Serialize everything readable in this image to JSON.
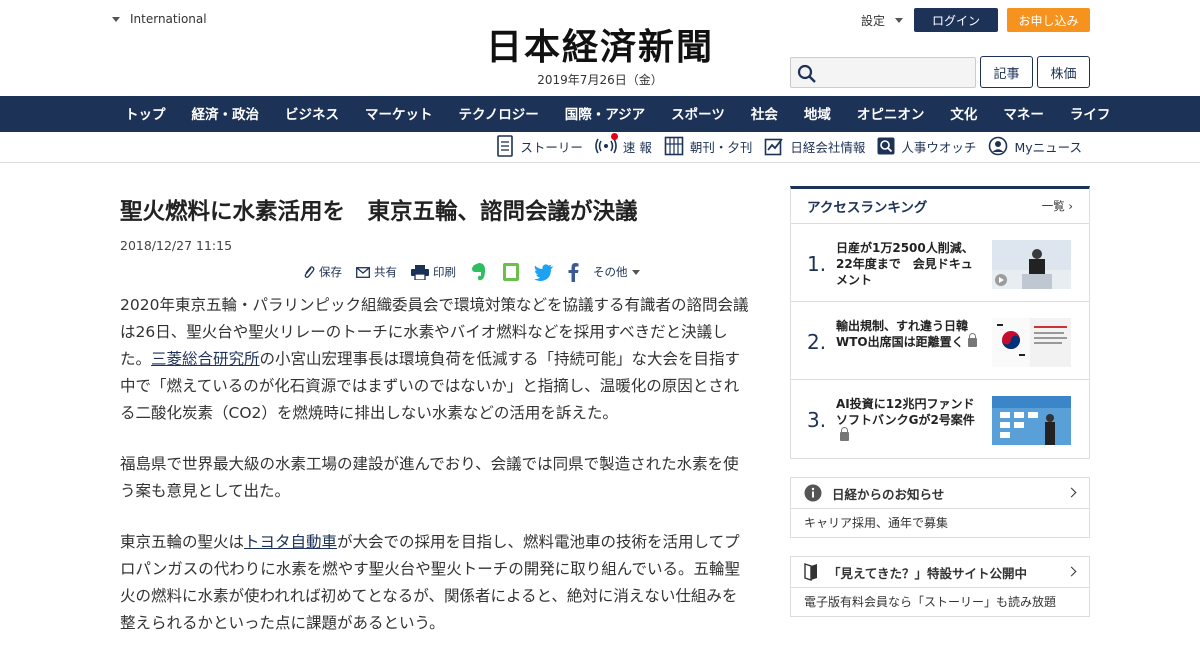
{
  "header": {
    "edition": "International",
    "logo_text": "日本経済新聞",
    "date": "2019年7月26日（金）",
    "settings_label": "設定",
    "login_label": "ログイン",
    "subscribe_label": "お申し込み",
    "search_placeholder": "",
    "articles_button": "記事",
    "stocks_button": "株価",
    "brand_color": "#1d3257",
    "accent_color": "#f5931e"
  },
  "nav": {
    "items": [
      "トップ",
      "経済・政治",
      "ビジネス",
      "マーケット",
      "テクノロジー",
      "国際・アジア",
      "スポーツ",
      "社会",
      "地域",
      "オピニオン",
      "文化",
      "マネー",
      "ライフ"
    ]
  },
  "subnav": {
    "items": [
      {
        "label": "ストーリー",
        "icon": "story-icon"
      },
      {
        "label": "速 報",
        "icon": "breaking-news-icon"
      },
      {
        "label": "朝刊・夕刊",
        "icon": "newspaper-icon"
      },
      {
        "label": "日経会社情報",
        "icon": "company-info-icon"
      },
      {
        "label": "人事ウオッチ",
        "icon": "people-watch-icon"
      },
      {
        "label": "Myニュース",
        "icon": "my-news-icon"
      }
    ]
  },
  "article": {
    "headline": "聖火燃料に水素活用を　東京五輪、諮問会議が決議",
    "published": "2018/12/27 11:15",
    "tools": {
      "save": "保存",
      "share": "共有",
      "print": "印刷",
      "more": "その他"
    },
    "p1_a": "2020年東京五輪・パラリンピック組織委員会で環境対策などを協議する有識者の諮問会議は26日、聖火台や聖火リレーのトーチに水素やバイオ燃料などを採用すべきだと決議した。",
    "p1_link": "三菱総合研究所",
    "p1_b": "の小宮山宏理事長は環境負荷を低減する「持続可能」な大会を目指す中で「燃えているのが化石資源ではまずいのではないか」と指摘し、温暖化の原因とされる二酸化炭素（CO2）を燃焼時に排出しない水素などの活用を訴えた。",
    "p2": "福島県で世界最大級の水素工場の建設が進んでおり、会議では同県で製造された水素を使う案も意見として出た。",
    "p3_a": "東京五輪の聖火は",
    "p3_link": "トヨタ自動車",
    "p3_b": "が大会での採用を目指し、燃料電池車の技術を活用してプロパンガスの代わりに水素を燃やす聖火台や聖火トーチの開発に取り組んでいる。五輪聖火の燃料に水素が使われれば初めてとなるが、関係者によると、絶対に消えない仕組みを整えられるかといった点に課題があるという。"
  },
  "sidebar": {
    "ranking_title": "アクセスランキング",
    "ranking_all": "一覧",
    "ranking": [
      {
        "num": "1.",
        "title": "日産が1万2500人削減、22年度まで　会見ドキュメント",
        "locked": false
      },
      {
        "num": "2.",
        "title": "輸出規制、すれ違う日韓　WTO出席国は距離置く",
        "locked": true
      },
      {
        "num": "3.",
        "title": "AI投資に12兆円ファンド　ソフトバンクGが2号案件",
        "locked": true
      }
    ],
    "notice_title": "日経からのお知らせ",
    "notice_body": "キャリア採用、通年で募集",
    "promo_title": "「見えてきた？」特設サイト公開中",
    "promo_body": "電子版有料会員なら「ストーリー」も読み放題"
  }
}
